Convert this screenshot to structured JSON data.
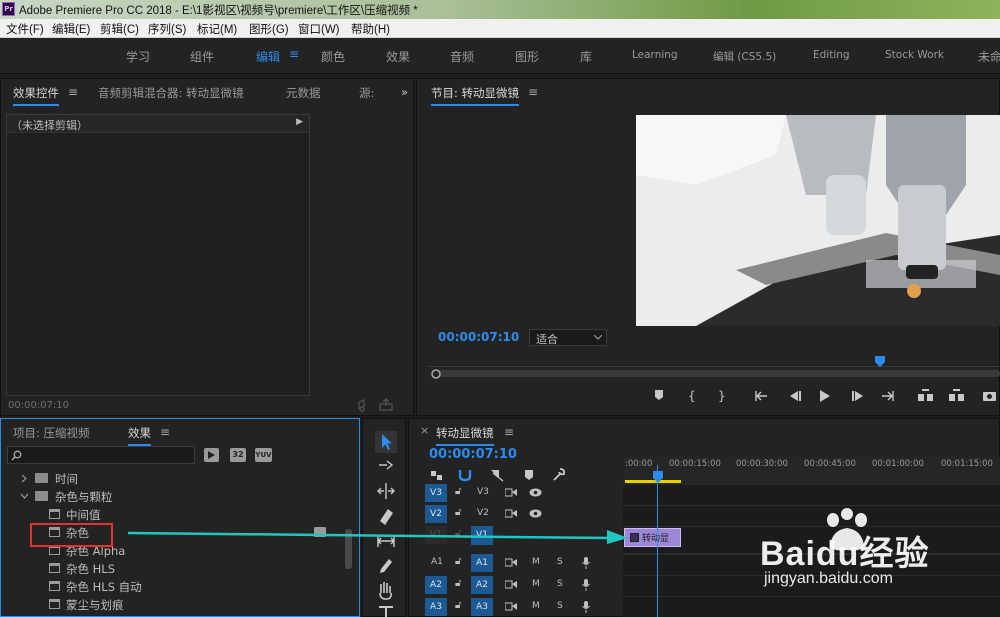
{
  "window": {
    "app_logo": "Pr",
    "title": "Adobe Premiere Pro CC 2018 - E:\\1影视区\\视频号\\premiere\\工作区\\压缩视频 *"
  },
  "menu": [
    "文件(F)",
    "编辑(E)",
    "剪辑(C)",
    "序列(S)",
    "标记(M)",
    "图形(G)",
    "窗口(W)",
    "帮助(H)"
  ],
  "workspaces": [
    "学习",
    "组件",
    "编辑",
    "颜色",
    "效果",
    "音频",
    "图形",
    "库",
    "Learning",
    "编辑 (CS5.5)",
    "Editing",
    "Stock Work",
    "未命"
  ],
  "workspace_menu_glyph": "≡",
  "effect_controls": {
    "tabs": [
      "效果控件",
      "音频剪辑混合器: 转动显微镜",
      "元数据",
      "源:"
    ],
    "menu_glyph": "≡",
    "overflow_glyph": "»",
    "no_clip": "（未选择剪辑）",
    "no_clip_arrow": "▶",
    "timecode": "00:00:07:10"
  },
  "program_monitor": {
    "title": "节目: 转动显微镜",
    "menu_glyph": "≡",
    "timecode": "00:00:07:10",
    "fit": "适合",
    "playhead_fraction": 0.79
  },
  "project": {
    "tabs": [
      "项目: 压缩视频",
      "效果"
    ],
    "menu_glyph": "≡",
    "badges": [
      "32",
      "YUV"
    ],
    "tree": [
      {
        "label": "时间",
        "type": "folder",
        "expanded": false,
        "indent": 0
      },
      {
        "label": "杂色与颗粒",
        "type": "folder",
        "expanded": true,
        "indent": 0
      },
      {
        "label": "中间值",
        "type": "effect",
        "indent": 1
      },
      {
        "label": "杂色",
        "type": "effect",
        "indent": 1,
        "highlighted": true
      },
      {
        "label": "杂色 Alpha",
        "type": "effect",
        "indent": 1
      },
      {
        "label": "杂色 HLS",
        "type": "effect",
        "indent": 1
      },
      {
        "label": "杂色 HLS 自动",
        "type": "effect",
        "indent": 1
      },
      {
        "label": "蒙尘与划痕",
        "type": "effect",
        "indent": 1
      }
    ],
    "highlight_color": "#e0342f"
  },
  "timeline": {
    "close_glyph": "×",
    "title": "转动显微镜",
    "menu_glyph": "≡",
    "timecode": "00:00:07:10",
    "ruler": [
      ":00:00",
      "00:00:15:00",
      "00:00:30:00",
      "00:00:45:00",
      "00:01:00:00",
      "00:01:15:00"
    ],
    "tracks": [
      {
        "src": "V3",
        "name": "V3",
        "kind": "video"
      },
      {
        "src": "V2",
        "name": "V2",
        "kind": "video"
      },
      {
        "src": "V1",
        "name": "V1",
        "kind": "video"
      },
      {
        "src": "A1",
        "name": "A1",
        "kind": "audio"
      },
      {
        "src": "A2",
        "name": "A2",
        "kind": "audio"
      },
      {
        "src": "A3",
        "name": "A3",
        "kind": "audio"
      }
    ],
    "track_buttons": {
      "mute": "M",
      "solo": "S"
    },
    "clip_label": "转动显",
    "clip_color": "#9b87d6"
  },
  "annotation": {
    "arrow_color": "#1fc7c2"
  },
  "watermark": {
    "brand": "Baidu经验",
    "url": "jingyan.baidu.com"
  },
  "colors": {
    "accent": "#2d8ceb",
    "panel": "#232323",
    "timecode": "#2d8ceb"
  }
}
